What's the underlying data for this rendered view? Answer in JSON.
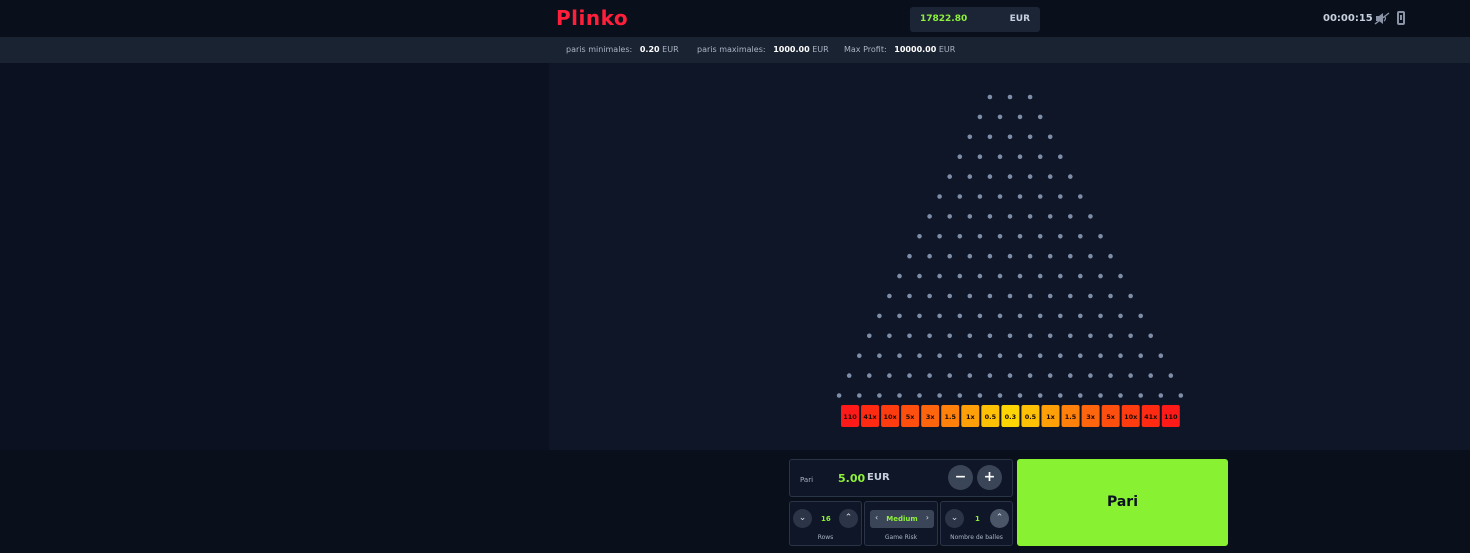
{
  "header": {
    "logo": "Plinko",
    "balance": {
      "amount": "17822.80",
      "currency": "EUR"
    },
    "timer": "00:00:15",
    "icons": [
      "sound-off-icon",
      "phone-icon"
    ]
  },
  "limits": {
    "min_label": "paris minimales:",
    "min_value": "0.20",
    "min_currency": "EUR",
    "max_label": "paris maximales:",
    "max_value": "1000.00",
    "max_currency": "EUR",
    "profit_label": "Max Profit:",
    "profit_value": "10000.00",
    "profit_currency": "EUR"
  },
  "board": {
    "rows": 16,
    "peg_color": "#7f8ea8",
    "multipliers": [
      "110",
      "41x",
      "10x",
      "5x",
      "3x",
      "1.5",
      "1x",
      "0.5",
      "0.3",
      "0.5",
      "1x",
      "1.5",
      "3x",
      "5x",
      "10x",
      "41x",
      "110"
    ],
    "bucket_colors": [
      "#ff1a1a",
      "#ff2a12",
      "#ff3b10",
      "#ff4f0e",
      "#ff650c",
      "#ff800a",
      "#ffa008",
      "#ffc105",
      "#ffd604",
      "#ffc105",
      "#ffa008",
      "#ff800a",
      "#ff650c",
      "#ff4f0e",
      "#ff3b10",
      "#ff2a12",
      "#ff1a1a"
    ]
  },
  "controls": {
    "bet": {
      "label": "Pari",
      "value": "5.00",
      "currency": "EUR",
      "minus": "−",
      "plus": "+"
    },
    "rows": {
      "value": "16",
      "label": "Rows",
      "down": "⌄",
      "up": "⌃"
    },
    "risk": {
      "value": "Medium",
      "label": "Game Risk",
      "prev": "‹",
      "next": "›"
    },
    "balls": {
      "value": "1",
      "label": "Nombre de balles",
      "down": "⌄",
      "up": "⌃"
    },
    "play_label": "Pari"
  },
  "colors": {
    "accent": "#88f232",
    "brand": "#ff1f3a",
    "background": "#0b1120"
  }
}
